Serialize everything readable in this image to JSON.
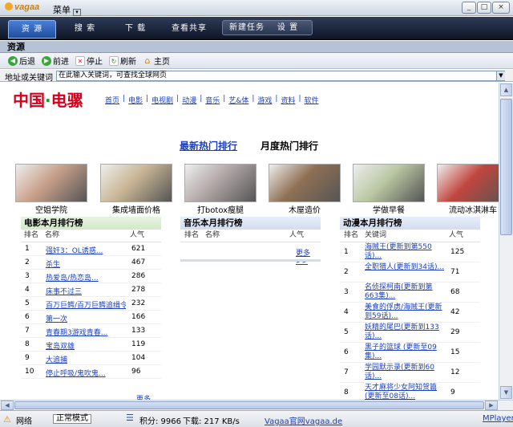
{
  "window": {
    "app_name": "vagaa",
    "menu_label": "菜单",
    "controls": [
      "_",
      "□",
      "×"
    ]
  },
  "nav": {
    "tabs": [
      "资 源",
      "搜 索",
      "下 载",
      "查看共享"
    ],
    "tasks": [
      "新建任务",
      "设 置"
    ]
  },
  "section_title": "资源",
  "toolbar": {
    "back": "后退",
    "forward": "前进",
    "stop": "停止",
    "refresh": "刷新",
    "home": "主页"
  },
  "address": {
    "label": "地址或关键词",
    "placeholder": "在此输入关键词，可查找全球网页"
  },
  "site": {
    "logo_a": "中国",
    "logo_dot": "·",
    "logo_b": "电骡",
    "nav": [
      "首页",
      "电影",
      "电视剧",
      "动漫",
      "音乐",
      "艺&体",
      "游戏",
      "资料",
      "软件"
    ],
    "headline_link": "最新热门排行",
    "headline_text": "月度热门排行"
  },
  "thumbs": [
    {
      "caption": "空姐学院",
      "color": "#c9a08a"
    },
    {
      "caption": "集成墙面价格",
      "color": "#c8b594"
    },
    {
      "caption": "打botox瘦腿",
      "color": "#b0a7a6"
    },
    {
      "caption": "木屋造价",
      "color": "#8f7054"
    },
    {
      "caption": "学做早餐",
      "color": "#b9c7a2"
    },
    {
      "caption": "流动冰淇淋车",
      "color": "#c0463d"
    }
  ],
  "movie_rank": {
    "title": "电影本月排行榜",
    "cols": [
      "排名",
      "名称",
      "人气"
    ],
    "rows": [
      {
        "n": "1",
        "t": "强奸3：OL诱惑...",
        "p": "621"
      },
      {
        "n": "2",
        "t": "杀生",
        "p": "467"
      },
      {
        "n": "3",
        "t": "热爱岛/热恋岛...",
        "p": "286"
      },
      {
        "n": "4",
        "t": "床事不过三",
        "p": "278"
      },
      {
        "n": "5",
        "t": "百万巨鳄/百万巨鳄追缉令...",
        "p": "232"
      },
      {
        "n": "6",
        "t": "第一次",
        "p": "166"
      },
      {
        "n": "7",
        "t": "青春期3游戏青春...",
        "p": "133"
      },
      {
        "n": "8",
        "t": "宝岛双雄",
        "p": "119"
      },
      {
        "n": "9",
        "t": "大追捕",
        "p": "104"
      },
      {
        "n": "10",
        "t": "停止呼吸/鬼吹鬼...",
        "p": "96"
      }
    ],
    "more": "更多>>"
  },
  "music_rank": {
    "title": "音乐本月排行榜",
    "cols": [
      "排名",
      "名称",
      "人气"
    ],
    "more": "更多>>"
  },
  "anime_rank": {
    "title": "动漫本月排行榜",
    "cols": [
      "排名",
      "关键词",
      "人气"
    ],
    "rows": [
      {
        "n": "1",
        "t": "海贼王(更新到第550话)...",
        "p": "125"
      },
      {
        "n": "2",
        "t": "全职猎人(更新到34话)...",
        "p": "71"
      },
      {
        "n": "3",
        "t": "名侦探柯南(更新到第663集)...",
        "p": "68"
      },
      {
        "n": "4",
        "t": "美食的俘虏/海贼王(更新到59话)...",
        "p": "42"
      },
      {
        "n": "5",
        "t": "妖精的尾巴(更新到133话)...",
        "p": "29"
      },
      {
        "n": "6",
        "t": "黑子的篮球 (更新至09集)...",
        "p": "15"
      },
      {
        "n": "7",
        "t": "学园默示录(更新到60话)...",
        "p": "12"
      },
      {
        "n": "8",
        "t": "天才麻将少女阿知贺篇(更新至08话)...",
        "p": "9"
      }
    ]
  },
  "status": {
    "network": "网络",
    "mode": "正常模式",
    "points": "积分: 9966",
    "download": "下载: 217 KB/s",
    "site_link": "Vagaa官网vagaa.de",
    "player": "MPlayer"
  }
}
